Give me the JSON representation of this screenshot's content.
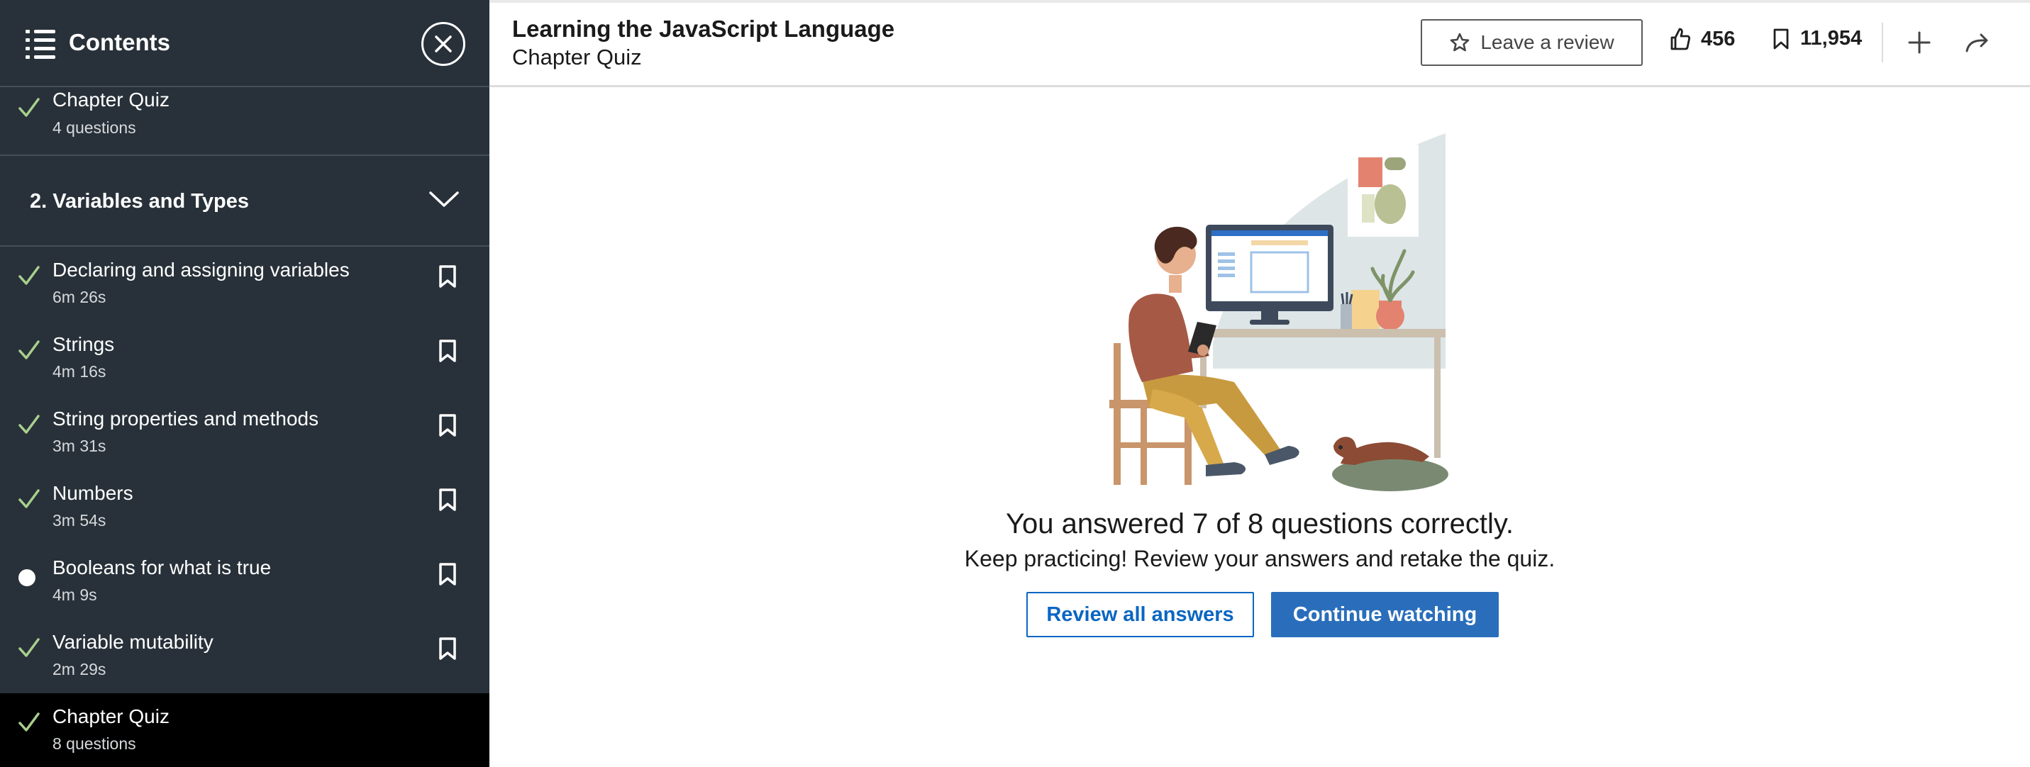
{
  "sidebar": {
    "title": "Contents",
    "previous_item": {
      "title": "Chapter Quiz",
      "meta": "4 questions",
      "status": "complete"
    },
    "section": {
      "title": "2. Variables and Types",
      "expanded": true
    },
    "items": [
      {
        "title": "Declaring and assigning variables",
        "meta": "6m 26s",
        "status": "complete"
      },
      {
        "title": "Strings",
        "meta": "4m 16s",
        "status": "complete"
      },
      {
        "title": "String properties and methods",
        "meta": "3m 31s",
        "status": "complete"
      },
      {
        "title": "Numbers",
        "meta": "3m 54s",
        "status": "complete"
      },
      {
        "title": "Booleans for what is true",
        "meta": "4m 9s",
        "status": "in-progress"
      },
      {
        "title": "Variable mutability",
        "meta": "2m 29s",
        "status": "complete"
      },
      {
        "title": "Chapter Quiz",
        "meta": "8 questions",
        "status": "complete",
        "active": true
      }
    ]
  },
  "header": {
    "course_title": "Learning the JavaScript Language",
    "subtitle": "Chapter Quiz",
    "review_label": "Leave a review",
    "likes": "456",
    "saves": "11,954"
  },
  "main": {
    "result": "You answered 7 of 8 questions correctly.",
    "message": "Keep practicing! Review your answers and retake the quiz.",
    "review_button": "Review all answers",
    "continue_button": "Continue watching"
  },
  "colors": {
    "sidebar_bg": "#283139",
    "active_row_bg": "#000000",
    "check_green": "#a8d08d",
    "primary_blue": "#2a6ebb"
  }
}
